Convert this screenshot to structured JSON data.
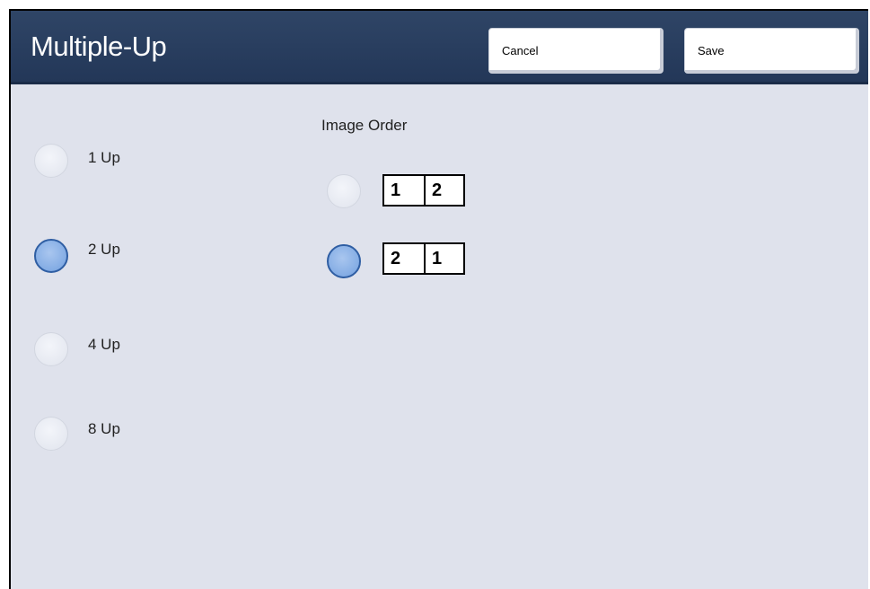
{
  "header": {
    "title": "Multiple-Up",
    "cancel_label": "Cancel",
    "save_label": "Save"
  },
  "pages_per_side": {
    "options": [
      {
        "label": "1 Up",
        "selected": false
      },
      {
        "label": "2 Up",
        "selected": true
      },
      {
        "label": "4 Up",
        "selected": false
      },
      {
        "label": "8 Up",
        "selected": false
      }
    ]
  },
  "image_order": {
    "label": "Image Order",
    "options": [
      {
        "first": "1",
        "second": "2",
        "selected": false
      },
      {
        "first": "2",
        "second": "1",
        "selected": true
      }
    ]
  },
  "colors": {
    "header_bg": "#233758",
    "panel_bg": "#dfe2ec",
    "radio_selected": "#86aee5",
    "radio_selected_border": "#2f5ea3"
  }
}
